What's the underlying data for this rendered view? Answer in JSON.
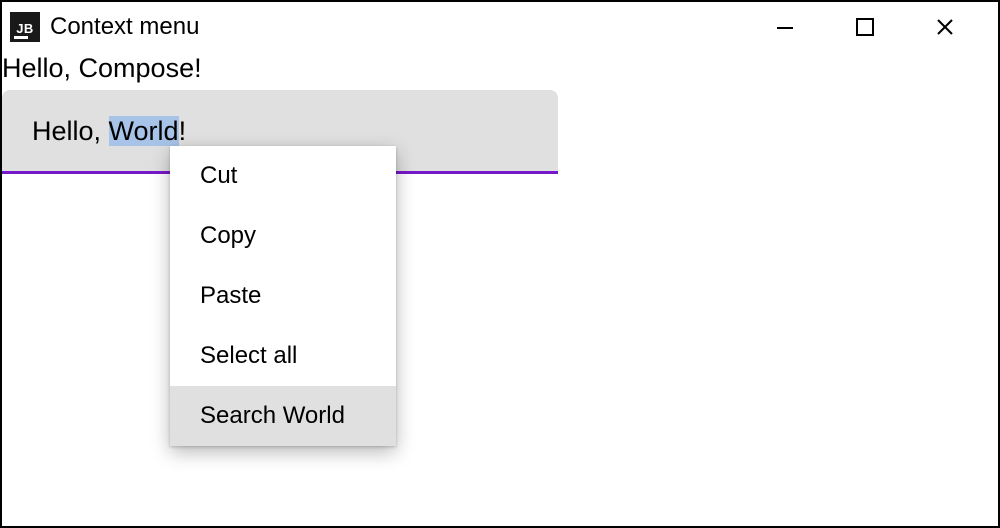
{
  "window": {
    "icon_label": "JB",
    "title": "Context menu"
  },
  "content": {
    "label": "Hello, Compose!",
    "textfield": {
      "prefix": "Hello, ",
      "selected": "World",
      "suffix": "!"
    }
  },
  "context_menu": {
    "items": [
      {
        "label": "Cut",
        "hover": false
      },
      {
        "label": "Copy",
        "hover": false
      },
      {
        "label": "Paste",
        "hover": false
      },
      {
        "label": "Select all",
        "hover": false
      },
      {
        "label": "Search World",
        "hover": true
      }
    ]
  }
}
